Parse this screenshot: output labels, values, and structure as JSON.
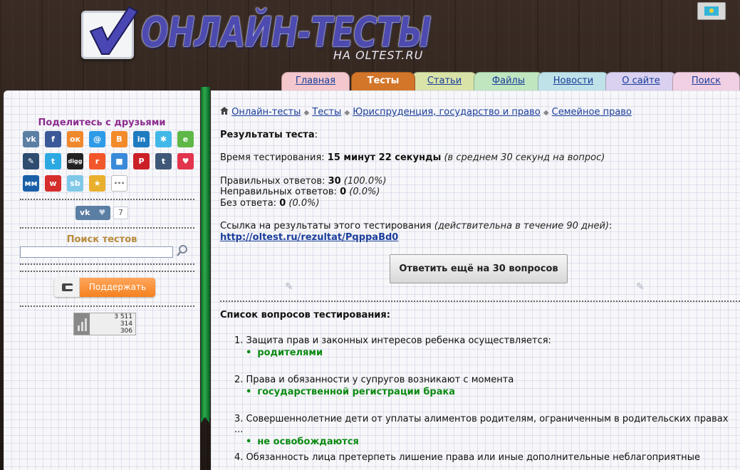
{
  "header": {
    "logo_title": "ОНЛАЙН-ТЕСТЫ",
    "logo_subtitle": "НА OLTEST.RU",
    "flag_icon": "kazakhstan-flag-icon"
  },
  "nav": {
    "tabs": [
      {
        "label": "Главная",
        "color": "#f4c7cc",
        "active": false
      },
      {
        "label": "Тесты",
        "color": "#d3762a",
        "active": true
      },
      {
        "label": "Статьи",
        "color": "#d9e3a8",
        "active": false
      },
      {
        "label": "Файлы",
        "color": "#bfe6bf",
        "active": false
      },
      {
        "label": "Новости",
        "color": "#bfe2e8",
        "active": false
      },
      {
        "label": "О сайте",
        "color": "#d9d1ef",
        "active": false
      },
      {
        "label": "Поиск",
        "color": "#f2d0e4",
        "active": false
      }
    ]
  },
  "sidebar": {
    "share_title": "Поделитесь с друзьями",
    "share_buttons": [
      {
        "name": "vk-icon",
        "glyph": "vk",
        "color": "#5b7ea3"
      },
      {
        "name": "facebook-icon",
        "glyph": "f",
        "color": "#3b5998"
      },
      {
        "name": "odnoklassniki-icon",
        "glyph": "ок",
        "color": "#f0882c"
      },
      {
        "name": "mailru-icon",
        "glyph": "@",
        "color": "#2e9be6"
      },
      {
        "name": "blogger-icon",
        "glyph": "B",
        "color": "#f38b2a"
      },
      {
        "name": "linkedin-icon",
        "glyph": "in",
        "color": "#1f7bc0"
      },
      {
        "name": "liveinternet-icon",
        "glyph": "✱",
        "color": "#42b8e8"
      },
      {
        "name": "evernote-icon",
        "glyph": "e",
        "color": "#5fb747"
      },
      {
        "name": "livejournal-icon",
        "glyph": "✎",
        "color": "#2d4c6f"
      },
      {
        "name": "twitter-icon",
        "glyph": "t",
        "color": "#2da9e1"
      },
      {
        "name": "digg-icon",
        "glyph": "digg",
        "color": "#222222"
      },
      {
        "name": "reddit-icon",
        "glyph": "r",
        "color": "#f2572a"
      },
      {
        "name": "delicious-icon",
        "glyph": "■",
        "color": "#3a8ad9"
      },
      {
        "name": "pinterest-icon",
        "glyph": "P",
        "color": "#cb2027"
      },
      {
        "name": "tumblr-icon",
        "glyph": "t",
        "color": "#3f5877"
      },
      {
        "name": "pocket-icon",
        "glyph": "♥",
        "color": "#e2344c"
      },
      {
        "name": "moi-mir-icon",
        "glyph": "мм",
        "color": "#1b5fa8"
      },
      {
        "name": "weibo-icon",
        "glyph": "w",
        "color": "#d62d2d"
      },
      {
        "name": "surfingbird-icon",
        "glyph": "sb",
        "color": "#7fc8e8"
      },
      {
        "name": "favorites-icon",
        "glyph": "★",
        "color": "#e8b02d"
      },
      {
        "name": "more-icon",
        "glyph": "•••",
        "color": "#ffffff"
      }
    ],
    "vk_like_count": "7",
    "search_title": "Поиск тестов",
    "search_placeholder": "",
    "support_label": "Поддержать",
    "counter_lines": [
      "3 511",
      "314",
      "306"
    ]
  },
  "breadcrumb": {
    "items": [
      "Онлайн-тесты",
      "Тесты",
      "Юриспруденция, государство и право",
      "Семейное право"
    ]
  },
  "results": {
    "heading": "Результаты теста",
    "time_label": "Время тестирования:",
    "time_value": "15 минут 22 секунды",
    "time_note": "(в среднем 30 секунд на вопрос)",
    "correct_label": "Правильных ответов:",
    "correct_value": "30",
    "correct_pct": "(100.0%)",
    "wrong_label": "Неправильных ответов:",
    "wrong_value": "0",
    "wrong_pct": "(0.0%)",
    "blank_label": "Без ответа:",
    "blank_value": "0",
    "blank_pct": "(0.0%)",
    "link_label": "Ссылка на результаты этого тестирования",
    "link_note": "(действительна в течение 90 дней)",
    "link_url": "http://oltest.ru/rezultat/PqppaBd0",
    "retry_button": "Ответить ещё на 30 вопросов"
  },
  "questions": {
    "heading": "Список вопросов тестирования:",
    "items": [
      {
        "text": "1. Защита прав и законных интересов ребенка осуществляется:",
        "answer": "родителями"
      },
      {
        "text": "2. Права и обязанности у супругов возникают с момента",
        "answer": "государственной регистрации брака"
      },
      {
        "text": "3. Совершеннолетние дети от уплаты алиментов родителям, ограниченным в родительских правах ...",
        "answer": "не освобождаются"
      },
      {
        "text": "4. Обязанность лица претерпеть лишение права или иные дополнительные неблагоприятные",
        "answer": ""
      }
    ]
  }
}
